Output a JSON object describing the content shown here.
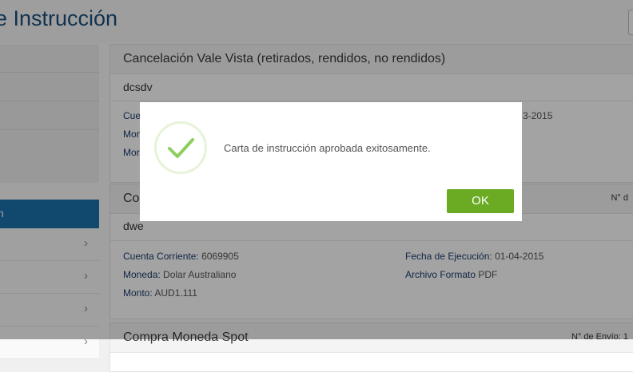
{
  "header": {
    "title": "e Instrucción"
  },
  "sidebar": {
    "active_label": "n",
    "chevron": "›"
  },
  "cards": [
    {
      "title": "Cancelación Vale Vista (retirados, rendidos, no rendidos)",
      "subtitle": "dcsdv",
      "partial_left": [
        "Cue",
        "Mon",
        "Mor"
      ],
      "partial_right": "3-2015"
    },
    {
      "title": "Com",
      "envio": "N° d",
      "subtitle": "dwe",
      "cuenta_label": "Cuenta Corriente:",
      "cuenta_value": "6069905",
      "moneda_label": "Moneda:",
      "moneda_value": "Dolar Australiano",
      "monto_label": "Monto:",
      "monto_value": "AUD1.111",
      "fecha_label": "Fecha de Ejecución:",
      "fecha_value": "01-04-2015",
      "archivo_label": "Archivo Formato",
      "archivo_value": "PDF"
    },
    {
      "title": "Compra Moneda Spot",
      "envio": "N° de Envío: 1"
    }
  ],
  "modal": {
    "icon": "checkmark-icon",
    "message": "Carta de instrucción aprobada exitosamente.",
    "ok_label": "OK",
    "accent_color": "#6bab24"
  }
}
